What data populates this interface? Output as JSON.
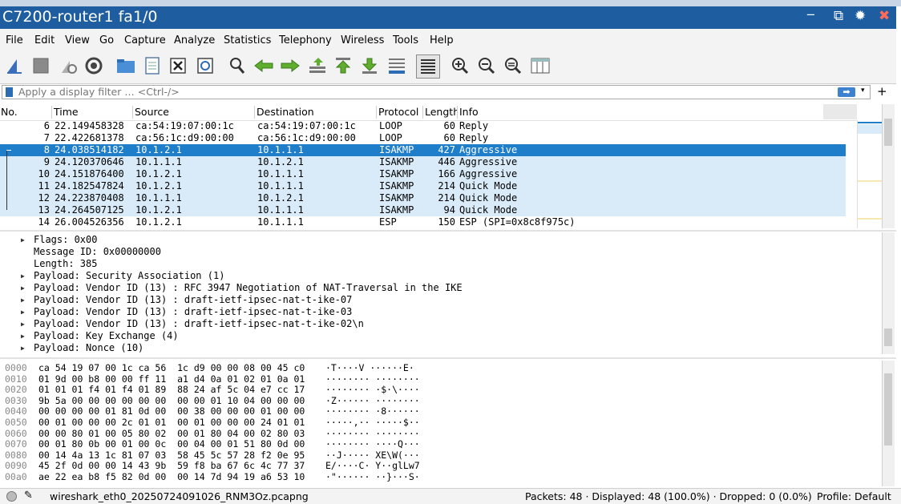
{
  "window": {
    "title": "C7200-router1 fa1/0"
  },
  "menu": [
    "File",
    "Edit",
    "View",
    "Go",
    "Capture",
    "Analyze",
    "Statistics",
    "Telephony",
    "Wireless",
    "Tools",
    "Help"
  ],
  "toolbar_icons": [
    "shark-fin-start-icon",
    "stop-icon",
    "restart-icon",
    "options-gear-icon",
    "open-folder-icon",
    "save-file-icon",
    "close-file-icon",
    "reload-icon",
    "find-icon",
    "back-arrow-icon",
    "forward-arrow-icon",
    "go-to-packet-icon",
    "first-packet-icon",
    "last-packet-icon",
    "auto-scroll-icon",
    "colorize-icon",
    "zoom-in-icon",
    "zoom-out-icon",
    "zoom-reset-icon",
    "resize-columns-icon"
  ],
  "filter": {
    "placeholder": "Apply a display filter … <Ctrl-/>"
  },
  "columns": [
    "No.",
    "Time",
    "Source",
    "Destination",
    "Protocol",
    "Length",
    "Info"
  ],
  "packets": [
    {
      "no": "6",
      "time": "22.149458328",
      "src": "ca:54:19:07:00:1c",
      "dst": "ca:54:19:07:00:1c",
      "proto": "LOOP",
      "len": "60",
      "info": "Reply",
      "state": "normal"
    },
    {
      "no": "7",
      "time": "22.422681378",
      "src": "ca:56:1c:d9:00:00",
      "dst": "ca:56:1c:d9:00:00",
      "proto": "LOOP",
      "len": "60",
      "info": "Reply",
      "state": "normal"
    },
    {
      "no": "8",
      "time": "24.038514182",
      "src": "10.1.2.1",
      "dst": "10.1.1.1",
      "proto": "ISAKMP",
      "len": "427",
      "info": "Aggressive",
      "state": "selected"
    },
    {
      "no": "9",
      "time": "24.120370646",
      "src": "10.1.1.1",
      "dst": "10.1.2.1",
      "proto": "ISAKMP",
      "len": "446",
      "info": "Aggressive",
      "state": "related"
    },
    {
      "no": "10",
      "time": "24.151876400",
      "src": "10.1.2.1",
      "dst": "10.1.1.1",
      "proto": "ISAKMP",
      "len": "166",
      "info": "Aggressive",
      "state": "related"
    },
    {
      "no": "11",
      "time": "24.182547824",
      "src": "10.1.2.1",
      "dst": "10.1.1.1",
      "proto": "ISAKMP",
      "len": "214",
      "info": "Quick Mode",
      "state": "related"
    },
    {
      "no": "12",
      "time": "24.223870408",
      "src": "10.1.1.1",
      "dst": "10.1.2.1",
      "proto": "ISAKMP",
      "len": "214",
      "info": "Quick Mode",
      "state": "related"
    },
    {
      "no": "13",
      "time": "24.264507125",
      "src": "10.1.2.1",
      "dst": "10.1.1.1",
      "proto": "ISAKMP",
      "len": "94",
      "info": "Quick Mode",
      "state": "related"
    },
    {
      "no": "14",
      "time": "26.004526356",
      "src": "10.1.2.1",
      "dst": "10.1.1.1",
      "proto": "ESP",
      "len": "150",
      "info": "ESP (SPI=0x8c8f975c)",
      "state": "normal"
    }
  ],
  "details": [
    {
      "text": "Flags: 0x00",
      "expandable": true
    },
    {
      "text": "Message ID: 0x00000000",
      "expandable": false
    },
    {
      "text": "Length: 385",
      "expandable": false
    },
    {
      "text": "Payload: Security Association (1)",
      "expandable": true
    },
    {
      "text": "Payload: Vendor ID (13) : RFC 3947 Negotiation of NAT-Traversal in the IKE",
      "expandable": true
    },
    {
      "text": "Payload: Vendor ID (13) : draft-ietf-ipsec-nat-t-ike-07",
      "expandable": true
    },
    {
      "text": "Payload: Vendor ID (13) : draft-ietf-ipsec-nat-t-ike-03",
      "expandable": true
    },
    {
      "text": "Payload: Vendor ID (13) : draft-ietf-ipsec-nat-t-ike-02\\n",
      "expandable": true
    },
    {
      "text": "Payload: Key Exchange (4)",
      "expandable": true
    },
    {
      "text": "Payload: Nonce (10)",
      "expandable": true
    }
  ],
  "bytes": [
    {
      "offset": "0000",
      "hex": "ca 54 19 07 00 1c ca 56  1c d9 00 00 08 00 45 c0",
      "ascii": "·T····V ······E·"
    },
    {
      "offset": "0010",
      "hex": "01 9d 00 b8 00 00 ff 11  a1 d4 0a 01 02 01 0a 01",
      "ascii": "········ ········"
    },
    {
      "offset": "0020",
      "hex": "01 01 01 f4 01 f4 01 89  88 24 af 5c 04 e7 cc 17",
      "ascii": "········ ·$·\\····"
    },
    {
      "offset": "0030",
      "hex": "9b 5a 00 00 00 00 00 00  00 00 01 10 04 00 00 00",
      "ascii": "·Z······ ········"
    },
    {
      "offset": "0040",
      "hex": "00 00 00 00 01 81 0d 00  00 38 00 00 00 01 00 00",
      "ascii": "········ ·8······"
    },
    {
      "offset": "0050",
      "hex": "00 01 00 00 00 2c 01 01  00 01 00 00 00 24 01 01",
      "ascii": "·····,·· ·····$··"
    },
    {
      "offset": "0060",
      "hex": "00 00 80 01 00 05 80 02  00 01 80 04 00 02 80 03",
      "ascii": "········ ········"
    },
    {
      "offset": "0070",
      "hex": "00 01 80 0b 00 01 00 0c  00 04 00 01 51 80 0d 00",
      "ascii": "········ ····Q···"
    },
    {
      "offset": "0080",
      "hex": "00 14 4a 13 1c 81 07 03  58 45 5c 57 28 f2 0e 95",
      "ascii": "··J····· XE\\W(···"
    },
    {
      "offset": "0090",
      "hex": "45 2f 0d 00 00 14 43 9b  59 f8 ba 67 6c 4c 77 37",
      "ascii": "E/····C· Y··glLw7"
    },
    {
      "offset": "00a0",
      "hex": "ae 22 ea b8 f5 82 0d 00  00 14 7d 94 19 a6 53 10",
      "ascii": "·\"······ ··}···S·"
    }
  ],
  "status": {
    "file": "wireshark_eth0_20250724091026_RNM3Oz.pcapng",
    "counts": "Packets: 48 · Displayed: 48 (100.0%) · Dropped: 0 (0.0%)",
    "profile": "Profile: Default"
  },
  "colors": {
    "titlebar": "#1d5da0",
    "selected": "#1f7ec9",
    "related": "#d9ebf8"
  }
}
